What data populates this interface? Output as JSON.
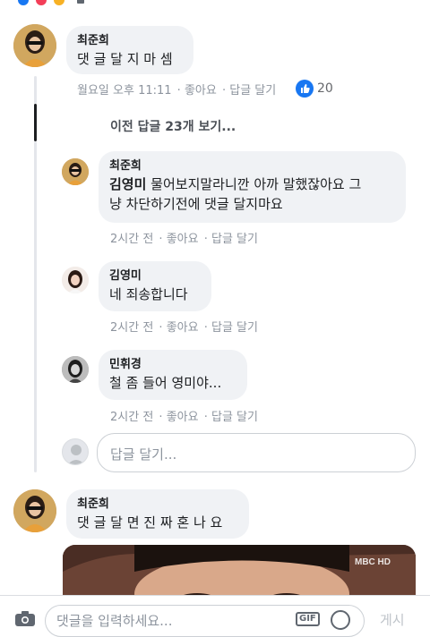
{
  "top_strip": {
    "icons": [
      "like-reaction-icon",
      "love-reaction-icon",
      "haha-reaction-icon"
    ]
  },
  "comment1": {
    "author": "최준희",
    "text": "댓 글 달 지 마 셈",
    "time": "월요일 오후 11:11",
    "like": "좋아요",
    "reply": "답글 달기",
    "like_count": "20"
  },
  "view_more": "이전 답글 23개 보기...",
  "replies": [
    {
      "author": "최준희",
      "mention": "김영미",
      "text_line1": " 물어보지말라니깐 아까 말했잖아요 그",
      "text_line2": "냥 차단하기전에 댓글 달지마요",
      "time": "2시간 전",
      "like": "좋아요",
      "reply": "답글 달기"
    },
    {
      "author": "김영미",
      "text": "네 죄송합니다",
      "time": "2시간 전",
      "like": "좋아요",
      "reply": "답글 달기"
    },
    {
      "author": "민휘경",
      "text": "철 좀 들어 영미야...",
      "time": "2시간 전",
      "like": "좋아요",
      "reply": "답글 달기"
    }
  ],
  "reply_input": {
    "placeholder": "답글 달기..."
  },
  "comment2": {
    "author": "최준희",
    "text": "댓 글 달 면 진 짜 혼 나 요",
    "image_watermark": "MBC HD"
  },
  "composer": {
    "placeholder": "댓글을 입력하세요...",
    "gif_label": "GIF",
    "send_label": "게시"
  },
  "colors": {
    "accent": "#1877f2",
    "bubble": "#f0f2f5",
    "meta": "#8d949e"
  }
}
